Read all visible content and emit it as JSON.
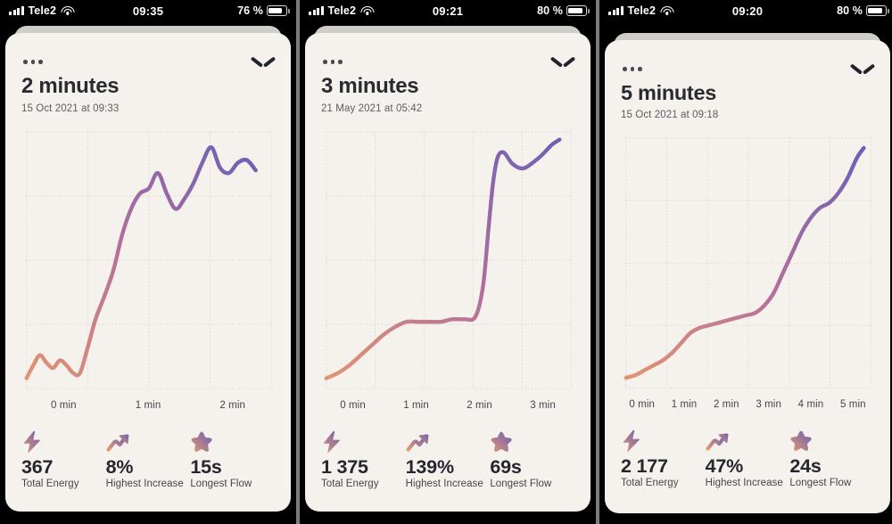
{
  "panels": [
    {
      "status": {
        "carrier": "Tele2",
        "time": "09:35",
        "battery": "76 %",
        "battery_level": 76,
        "signal_icon": "cellular-bars-icon",
        "wifi_icon": "wifi-icon",
        "battery_icon": "battery-icon"
      },
      "menu_icon": "more-options-icon",
      "collapse_icon": "chevron-down-icon",
      "title": "2 minutes",
      "subtitle": "15 Oct 2021 at 09:33",
      "xticks": [
        "0 min",
        "1 min",
        "2 min"
      ],
      "stats": [
        {
          "icon": "lightning-bolt-icon",
          "value": "367",
          "label": "Total Energy"
        },
        {
          "icon": "trending-up-icon",
          "value": "8%",
          "label": "Highest Increase"
        },
        {
          "icon": "star-icon",
          "value": "15s",
          "label": "Longest Flow"
        }
      ],
      "chart_data": {
        "type": "line",
        "title": "2 minutes",
        "xlabel": "",
        "ylabel": "",
        "xtick_labels": [
          "0 min",
          "1 min",
          "2 min"
        ],
        "xlim": [
          0,
          2.2
        ],
        "ylim": [
          0,
          100
        ],
        "grid": true,
        "line_gradient": [
          "#e09571",
          "#6b5fb5"
        ],
        "x": [
          0.0,
          0.06,
          0.12,
          0.18,
          0.24,
          0.3,
          0.36,
          0.42,
          0.48,
          0.55,
          0.62,
          0.7,
          0.78,
          0.86,
          0.94,
          1.02,
          1.1,
          1.18,
          1.26,
          1.34,
          1.42,
          1.5,
          1.58,
          1.66,
          1.74,
          1.82,
          1.9,
          1.98,
          2.06
        ],
        "y": [
          4,
          9,
          13,
          10,
          8,
          11,
          9,
          6,
          6,
          16,
          27,
          36,
          46,
          60,
          70,
          76,
          78,
          84,
          76,
          70,
          74,
          80,
          88,
          94,
          86,
          84,
          88,
          89,
          85
        ]
      }
    },
    {
      "status": {
        "carrier": "Tele2",
        "time": "09:21",
        "battery": "80 %",
        "battery_level": 80,
        "signal_icon": "cellular-bars-icon",
        "wifi_icon": "wifi-icon",
        "battery_icon": "battery-icon"
      },
      "menu_icon": "more-options-icon",
      "collapse_icon": "chevron-down-icon",
      "title": "3 minutes",
      "subtitle": "21 May 2021 at 05:42",
      "xticks": [
        "0 min",
        "1 min",
        "2 min",
        "3 min"
      ],
      "stats": [
        {
          "icon": "lightning-bolt-icon",
          "value": "1 375",
          "label": "Total Energy"
        },
        {
          "icon": "trending-up-icon",
          "value": "139%",
          "label": "Highest Increase"
        },
        {
          "icon": "star-icon",
          "value": "69s",
          "label": "Longest Flow"
        }
      ],
      "chart_data": {
        "type": "line",
        "title": "3 minutes",
        "xlabel": "",
        "ylabel": "",
        "xtick_labels": [
          "0 min",
          "1 min",
          "2 min",
          "3 min"
        ],
        "xlim": [
          0,
          3.2
        ],
        "ylim": [
          0,
          100
        ],
        "grid": true,
        "line_gradient": [
          "#e09571",
          "#6b5fb5"
        ],
        "x": [
          0.0,
          0.15,
          0.3,
          0.45,
          0.6,
          0.75,
          0.9,
          1.05,
          1.2,
          1.35,
          1.5,
          1.65,
          1.8,
          1.95,
          2.05,
          2.12,
          2.18,
          2.24,
          2.32,
          2.42,
          2.52,
          2.6,
          2.7,
          2.82,
          2.95,
          3.05
        ],
        "y": [
          4,
          6,
          9,
          13,
          17,
          21,
          24,
          26,
          26,
          26,
          26,
          27,
          27,
          28,
          40,
          62,
          80,
          90,
          92,
          88,
          86,
          86,
          88,
          91,
          95,
          97
        ]
      }
    },
    {
      "status": {
        "carrier": "Tele2",
        "time": "09:20",
        "battery": "80 %",
        "battery_level": 80,
        "signal_icon": "cellular-bars-icon",
        "wifi_icon": "wifi-icon",
        "battery_icon": "battery-icon"
      },
      "menu_icon": "more-options-icon",
      "collapse_icon": "chevron-down-icon",
      "title": "5 minutes",
      "subtitle": "15 Oct 2021 at 09:18",
      "xticks": [
        "0 min",
        "1 min",
        "2 min",
        "3 min",
        "4 min",
        "5 min"
      ],
      "stats": [
        {
          "icon": "lightning-bolt-icon",
          "value": "2 177",
          "label": "Total Energy"
        },
        {
          "icon": "trending-up-icon",
          "value": "47%",
          "label": "Highest Increase"
        },
        {
          "icon": "star-icon",
          "value": "24s",
          "label": "Longest Flow"
        }
      ],
      "chart_data": {
        "type": "line",
        "title": "5 minutes",
        "xlabel": "",
        "ylabel": "",
        "xtick_labels": [
          "0 min",
          "1 min",
          "2 min",
          "3 min",
          "4 min",
          "5 min"
        ],
        "xlim": [
          0,
          5.3
        ],
        "ylim": [
          0,
          100
        ],
        "grid": true,
        "line_gradient": [
          "#e09571",
          "#6b5fb5"
        ],
        "x": [
          0.0,
          0.2,
          0.4,
          0.6,
          0.8,
          1.0,
          1.2,
          1.4,
          1.6,
          1.8,
          2.0,
          2.2,
          2.4,
          2.6,
          2.8,
          3.0,
          3.2,
          3.4,
          3.6,
          3.8,
          4.0,
          4.2,
          4.4,
          4.6,
          4.8,
          5.0,
          5.15
        ],
        "y": [
          4,
          5,
          7,
          9,
          11,
          14,
          18,
          22,
          24,
          25,
          26,
          27,
          28,
          29,
          30,
          33,
          38,
          46,
          54,
          62,
          68,
          72,
          74,
          78,
          84,
          92,
          96
        ]
      }
    }
  ],
  "theme": {
    "card_bg": "#f5f2ed",
    "page_bg": "#7c7c7c",
    "status_bg": "#000000",
    "text_primary": "#26262e",
    "text_secondary": "#44444b",
    "gradient_start": "#e09571",
    "gradient_end": "#6b5fb5"
  }
}
